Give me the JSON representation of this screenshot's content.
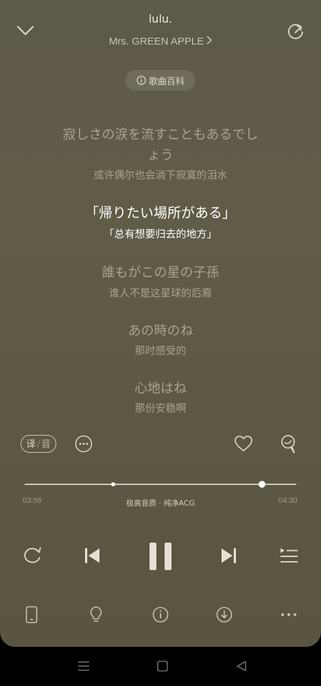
{
  "header": {
    "title": "lulu.",
    "artist": "Mrs. GREEN APPLE",
    "wiki_label": "歌曲百科"
  },
  "lyrics": [
    {
      "ja_line1": "寂しさの涙を流すこともあるでし",
      "ja_line2": "ょう",
      "zh": "或许偶尔也会淌下寂寞的泪水"
    },
    {
      "ja_line1": "「帰りたい場所がある」",
      "zh": "「总有想要归去的地方」",
      "active": true
    },
    {
      "ja_line1": "誰もがこの星の子孫",
      "zh": "谁人不是这星球的后裔"
    },
    {
      "ja_line1": "あの時のね",
      "zh": "那时感受的"
    },
    {
      "ja_line1": "心地はね",
      "zh": "那份安稳啊"
    }
  ],
  "toggle": {
    "translate": "译",
    "sep": "/",
    "sound": "音"
  },
  "player": {
    "current_time": "03:56",
    "total_time": "04:30",
    "quality": "极高音质 · 纯净ACG",
    "progress": 0.874
  },
  "colors": {
    "background": "#5e5a48",
    "accent": "#ffffff"
  },
  "icons": {
    "collapse": "chevron-down-icon",
    "share": "share-icon",
    "more": "more-circle-icon",
    "like": "heart-icon",
    "comment": "comment-icon",
    "loop": "repeat-icon",
    "prev": "previous-icon",
    "play_pause": "pause-icon",
    "next": "next-icon",
    "playlist": "playlist-icon",
    "device": "phone-icon",
    "hint": "lightbulb-icon",
    "info": "info-icon",
    "download": "download-icon",
    "overflow": "more-horizontal-icon"
  }
}
